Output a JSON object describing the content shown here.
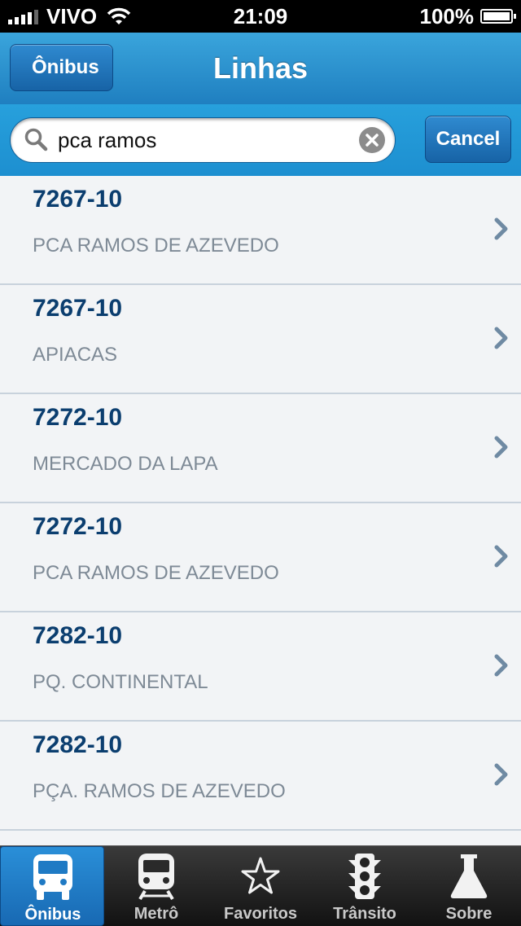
{
  "status_bar": {
    "carrier": "VIVO",
    "time": "21:09",
    "battery": "100%"
  },
  "nav": {
    "back_label": "Ônibus",
    "title": "Linhas"
  },
  "search": {
    "query": "pca ramos",
    "cancel_label": "Cancel"
  },
  "routes": [
    {
      "number": "7267-10",
      "destination": "PCA RAMOS DE AZEVEDO"
    },
    {
      "number": "7267-10",
      "destination": "APIACAS"
    },
    {
      "number": "7272-10",
      "destination": "MERCADO DA LAPA"
    },
    {
      "number": "7272-10",
      "destination": "PCA RAMOS DE AZEVEDO"
    },
    {
      "number": "7282-10",
      "destination": "PQ. CONTINENTAL"
    },
    {
      "number": "7282-10",
      "destination": "PÇA. RAMOS DE AZEVEDO"
    }
  ],
  "tabs": [
    {
      "label": "Ônibus",
      "icon": "bus-icon",
      "active": true
    },
    {
      "label": "Metrô",
      "icon": "train-icon",
      "active": false
    },
    {
      "label": "Favoritos",
      "icon": "star-icon",
      "active": false
    },
    {
      "label": "Trânsito",
      "icon": "traffic-light-icon",
      "active": false
    },
    {
      "label": "Sobre",
      "icon": "flask-icon",
      "active": false
    }
  ],
  "colors": {
    "nav_blue": "#1f7fc0",
    "route_number": "#0b3e6f",
    "destination_gray": "#7e8a96",
    "tab_active": "#1869b3"
  }
}
